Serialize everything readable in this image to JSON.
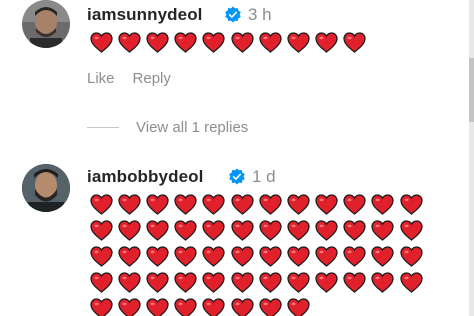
{
  "comments": [
    {
      "username": "iamsunnydeol",
      "time": "3 h",
      "heart_count": 10,
      "actions": {
        "like_label": "Like",
        "reply_label": "Reply"
      },
      "view_replies_label": "View all 1 replies"
    },
    {
      "username": "iambobbydeol",
      "time": "1 d",
      "heart_count": 56
    }
  ],
  "colors": {
    "heart": "#e0202b",
    "verified": "#0095f6",
    "username": "#262626",
    "muted": "#8e8e8e"
  },
  "icons": {
    "verified": "verified-badge-icon",
    "heart": "red-heart-emoji-icon"
  }
}
